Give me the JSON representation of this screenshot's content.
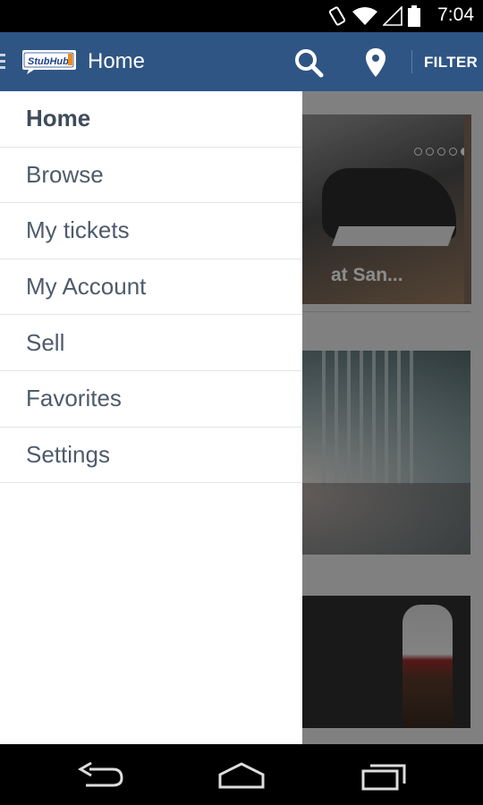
{
  "status_bar": {
    "time": "7:04",
    "icons": [
      "rotation-lock-icon",
      "wifi-icon",
      "signal-icon",
      "battery-icon"
    ]
  },
  "action_bar": {
    "logo_text": "StubHub!",
    "title": "Home",
    "filter_label": "FILTER",
    "color": "#2f5584"
  },
  "drawer": {
    "items": [
      {
        "label": "Home",
        "active": true
      },
      {
        "label": "Browse",
        "active": false
      },
      {
        "label": "My tickets",
        "active": false
      },
      {
        "label": "My Account",
        "active": false
      },
      {
        "label": "Sell",
        "active": false
      },
      {
        "label": "Favorites",
        "active": false
      },
      {
        "label": "Settings",
        "active": false
      }
    ]
  },
  "content": {
    "cards": [
      {
        "caption": "at San..."
      },
      {
        "caption": ""
      },
      {
        "caption": ""
      }
    ]
  },
  "nav_bar": {
    "buttons": [
      "back-icon",
      "home-icon",
      "recent-apps-icon"
    ]
  }
}
